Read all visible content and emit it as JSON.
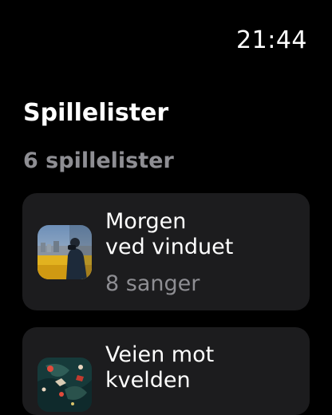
{
  "status": {
    "time": "21:44"
  },
  "header": {
    "title": "Spillelister",
    "count_label": "6 spillelister"
  },
  "playlists": [
    {
      "title_line1": "Morgen",
      "title_line2": "ved vinduet",
      "subtitle": "8 sanger",
      "artwork": "person-at-window-image"
    },
    {
      "title_line1": "Veien mot",
      "title_line2": "kvelden",
      "subtitle": "",
      "artwork": "abstract-map-image"
    }
  ]
}
